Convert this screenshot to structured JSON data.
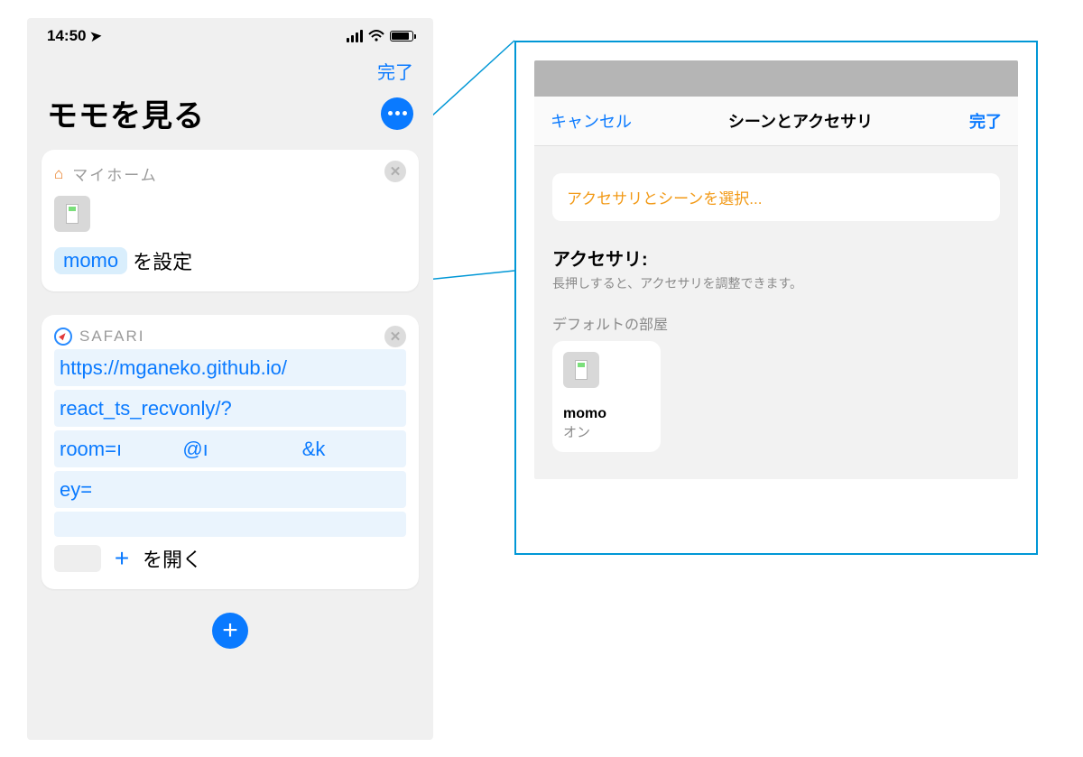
{
  "status": {
    "time": "14:50"
  },
  "top_done": "完了",
  "title": "モモを見る",
  "card_home": {
    "header": "マイホーム",
    "token": "momo",
    "action_tail": "を設定"
  },
  "card_safari": {
    "header": "SAFARI",
    "url_line1": "https://mganeko.github.io/",
    "url_line2": "react_ts_recvonly/?",
    "url_line3_a": "room=ı",
    "url_line3_b": "@ı",
    "url_line3_c": "&k",
    "url_line4": "ey=",
    "open_tail": "を開く"
  },
  "modal": {
    "cancel": "キャンセル",
    "title": "シーンとアクセサリ",
    "done": "完了",
    "select_prompt": "アクセサリとシーンを選択...",
    "section_title": "アクセサリ:",
    "section_sub": "長押しすると、アクセサリを調整できます。",
    "room": "デフォルトの部屋",
    "accessory": {
      "name": "momo",
      "state": "オン"
    }
  }
}
